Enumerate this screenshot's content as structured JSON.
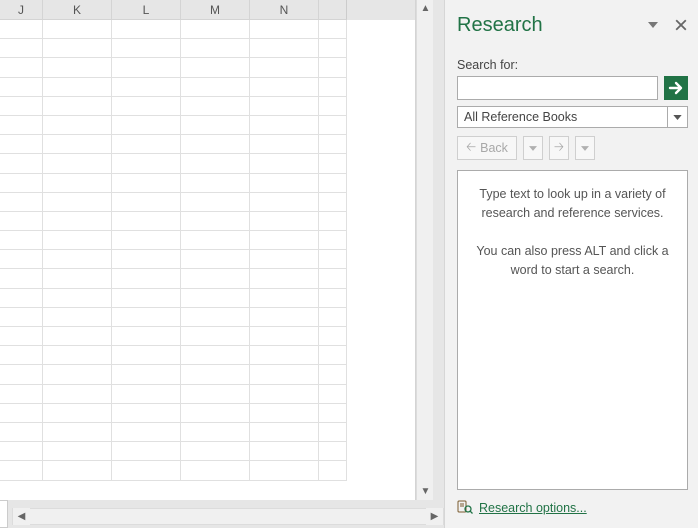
{
  "grid": {
    "columns": [
      "J",
      "K",
      "L",
      "M",
      "N"
    ]
  },
  "panel": {
    "title": "Research",
    "search_label": "Search for:",
    "search_value": "",
    "source_selected": "All Reference Books",
    "back_label": "Back",
    "hint_line1": "Type text to look up in a variety of research and reference services.",
    "hint_line2": "You can also press ALT and click a word to start a search.",
    "options_label": "Research options..."
  }
}
